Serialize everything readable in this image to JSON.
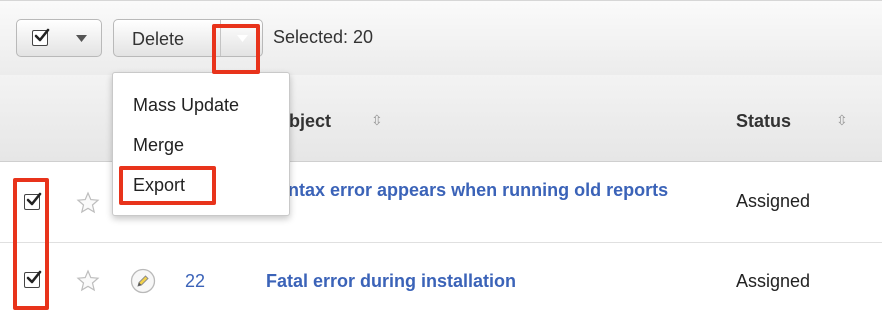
{
  "toolbar": {
    "delete_label": "Delete",
    "selected_label": "Selected: 20"
  },
  "menu": {
    "items": [
      "Mass Update",
      "Merge",
      "Export"
    ]
  },
  "columns": {
    "subject": "Subject",
    "status": "Status"
  },
  "rows": [
    {
      "number": "",
      "subject": "Syntax error appears when running old reports",
      "status": "Assigned",
      "checked": true
    },
    {
      "number": "22",
      "subject": "Fatal error during installation",
      "status": "Assigned",
      "checked": true
    }
  ],
  "colors": {
    "link": "#3b63b8",
    "highlight": "#e8331b"
  }
}
